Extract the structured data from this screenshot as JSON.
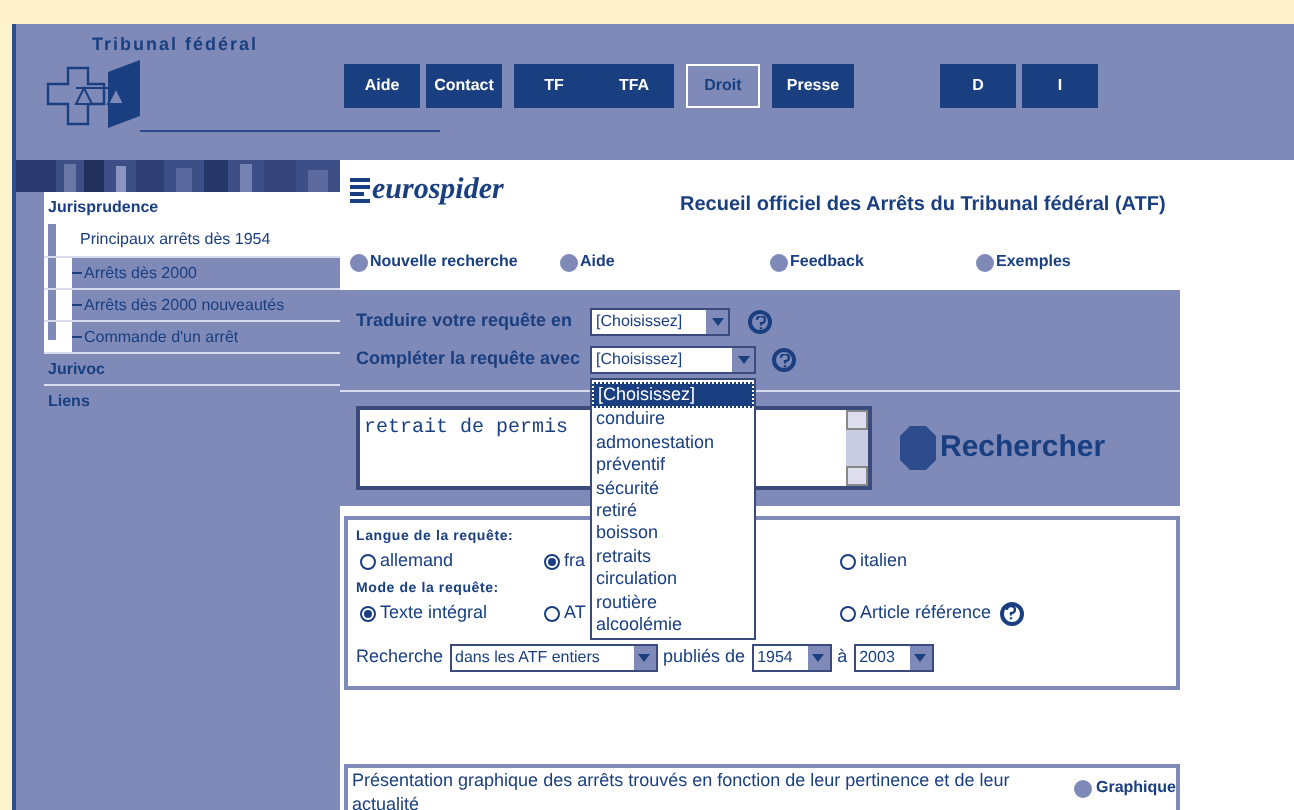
{
  "header": {
    "title": "Tribunal fédéral",
    "nav": [
      {
        "label": "Aide",
        "selected": false
      },
      {
        "label": "Contact",
        "selected": false
      },
      {
        "label": "TF",
        "selected": false
      },
      {
        "label": "TFA",
        "selected": false
      },
      {
        "label": "Droit",
        "selected": true
      },
      {
        "label": "Presse",
        "selected": false
      },
      {
        "label": "D",
        "selected": false
      },
      {
        "label": "I",
        "selected": false
      }
    ]
  },
  "sidebar": {
    "items": [
      {
        "label": "Jurisprudence",
        "selected": true,
        "children": [
          {
            "label": "Principaux arrêts dès 1954",
            "selected": true
          },
          {
            "label": "Arrêts dès 2000",
            "selected": false
          },
          {
            "label": "Arrêts dès 2000 nouveautés",
            "selected": false
          },
          {
            "label": "Commande d'un arrêt",
            "selected": false
          }
        ]
      },
      {
        "label": "Jurivoc",
        "selected": false
      },
      {
        "label": "Liens",
        "selected": false
      }
    ]
  },
  "main": {
    "logo": "eurospider",
    "title": "Recueil officiel des Arrêts du Tribunal fédéral (ATF)",
    "links": [
      "Nouvelle recherche",
      "Aide",
      "Feedback",
      "Exemples"
    ],
    "translate": {
      "label": "Traduire votre requête en",
      "value": "[Choisissez]"
    },
    "complete": {
      "label": "Compléter la requête avec",
      "value": "[Choisissez]",
      "options": [
        {
          "label": "[Choisissez]",
          "selected": true
        },
        {
          "label": "conduire",
          "selected": false
        },
        {
          "label": "admonestation",
          "selected": false
        },
        {
          "label": "préventif",
          "selected": false
        },
        {
          "label": "sécurité",
          "selected": false
        },
        {
          "label": "retiré",
          "selected": false
        },
        {
          "label": "boisson",
          "selected": false
        },
        {
          "label": "retraits",
          "selected": false
        },
        {
          "label": "circulation",
          "selected": false
        },
        {
          "label": "routière",
          "selected": false
        },
        {
          "label": "alcoolémie",
          "selected": false
        }
      ]
    },
    "query": {
      "value": "retrait de permis"
    },
    "search_button": "Rechercher",
    "language": {
      "label": "Langue de la requête:",
      "options": [
        {
          "label": "allemand",
          "selected": false
        },
        {
          "label": "fra",
          "selected": true
        },
        {
          "label": "italien",
          "selected": false
        }
      ]
    },
    "mode": {
      "label": "Mode de la requête:",
      "options": [
        {
          "label": "Texte intégral",
          "selected": true
        },
        {
          "label": "AT",
          "selected": false
        },
        {
          "label": "Article référence",
          "selected": false
        }
      ]
    },
    "search_row": {
      "prefix": "Recherche",
      "scope": "dans les ATF entiers",
      "published": "publiés de",
      "from": "1954",
      "to_label": "à",
      "to": "2003"
    },
    "graph": {
      "text": "Présentation graphique des arrêts trouvés en fonction de leur pertinence et de leur actualité",
      "button": "Graphique"
    }
  }
}
